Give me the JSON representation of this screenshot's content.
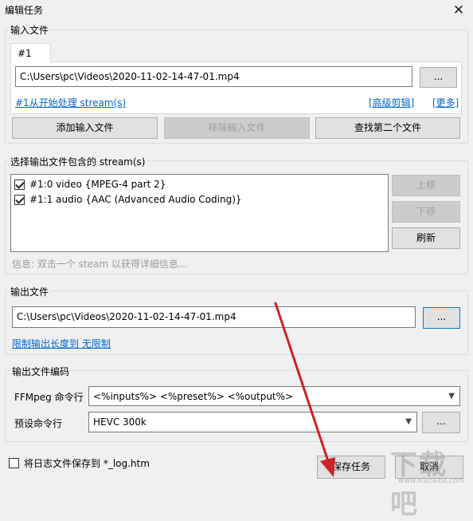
{
  "window": {
    "title": "编辑任务",
    "close_icon": "✕"
  },
  "input_files": {
    "group_label": "输入文件",
    "tab_label": "#1",
    "file_path": "C:\\Users\\pc\\Videos\\2020-11-02-14-47-01.mp4",
    "browse_label": "...",
    "stream_link": "#1从开始处理 stream(s)",
    "advanced_cut_link": "[高级剪辑]",
    "more_link": "[更多]",
    "add_label": "添加输入文件",
    "remove_label": "移除输入文件",
    "find_second_label": "查找第二个文件"
  },
  "streams": {
    "group_label": "选择输出文件包含的 stream(s)",
    "items": [
      {
        "label": "#1:0 video {MPEG-4 part 2}",
        "checked": true
      },
      {
        "label": "#1:1 audio {AAC (Advanced Audio Coding)}",
        "checked": true
      }
    ],
    "up_label": "上移",
    "down_label": "下移",
    "refresh_label": "刷新",
    "info_text": "信息: 双击一个 steam 以获得详细信息..."
  },
  "output_file": {
    "group_label": "输出文件",
    "file_path": "C:\\Users\\pc\\Videos\\2020-11-02-14-47-01.mp4",
    "browse_label": "...",
    "limit_link": "限制输出长度到 无限制"
  },
  "encoding": {
    "group_label": "输出文件编码",
    "ffmpeg_label": "FFMpeg 命令行",
    "ffmpeg_value": "<%inputs%> <%preset%> <%output%>",
    "preset_label": "预设命令行",
    "preset_value": "HEVC 300k",
    "preset_browse_label": "..."
  },
  "footer": {
    "save_log_label": "将日志文件保存到 *_log.htm",
    "save_log_checked": false,
    "save_task_label": "保存任务",
    "cancel_label": "取消"
  },
  "watermark": {
    "text": "下载吧",
    "url_text": "www.xiazaiba.com"
  },
  "colors": {
    "link": "#0066cc",
    "arrow": "#d0202a",
    "focus": "#0078d7"
  }
}
